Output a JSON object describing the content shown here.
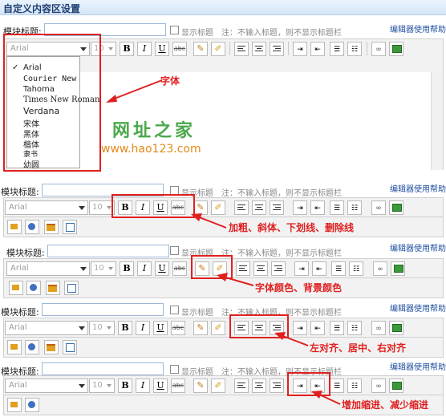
{
  "window_title": "自定义内容区设置",
  "module_title_label": "模块标题:",
  "show_title_label": "显示标题",
  "note_text": "注：不输入标题，则不显示标题栏",
  "help_link": "编辑器使用帮助",
  "font_family_value": "Arial",
  "font_size_value": "10",
  "buttons": {
    "bold": "B",
    "italic": "I",
    "underline": "U",
    "strike": "abc"
  },
  "font_options": [
    "Arial",
    "Courier New",
    "Tahoma",
    "Times New Roman",
    "Verdana",
    "宋体",
    "黑体",
    "楷体",
    "隶书",
    "幼圆"
  ],
  "watermark": {
    "text": "网址之家",
    "url": "www.hao123.com"
  },
  "annotations": {
    "font": "字体",
    "format": "加粗、斜体、下划线、删除线",
    "color": "字体颜色、背景颜色",
    "align": "左对齐、居中、右对齐",
    "indent": "增加缩进、减少缩进"
  },
  "colors": {
    "annotation": "#e02020",
    "link": "#1f4fa0",
    "titlebar": "#d5e6f7"
  }
}
